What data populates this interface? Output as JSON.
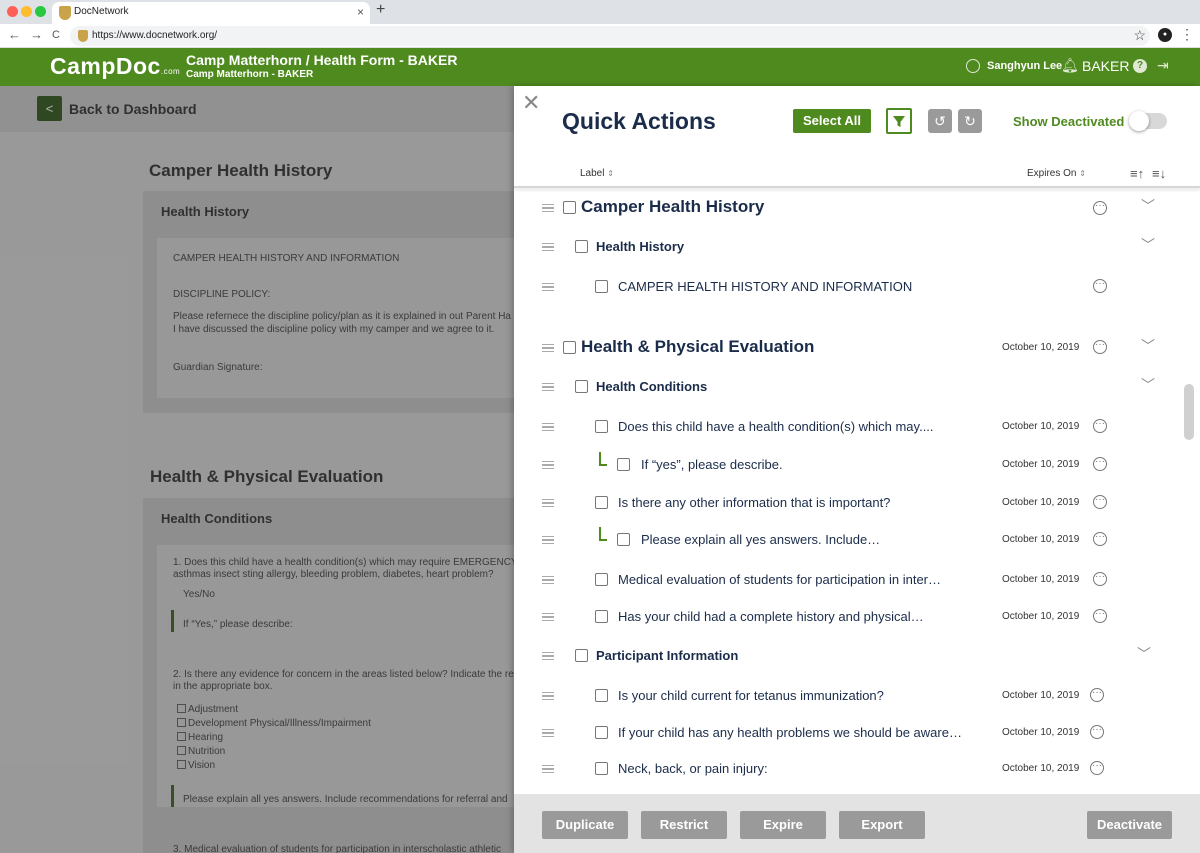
{
  "browser": {
    "tab_title": "DocNetwork",
    "tab_close": "×",
    "new_tab": "+",
    "url": "https://www.docnetwork.org/",
    "back": "←",
    "forward": "→",
    "reload": "C",
    "star": "☆",
    "menu": "⋮"
  },
  "app": {
    "logo": "CampDoc",
    "logo_suffix": ".com",
    "title": "Camp Matterhorn / Health Form - BAKER",
    "subtitle": "Camp Matterhorn - BAKER",
    "user_name": "Sanghyun Lee",
    "camp_code": "BAKER",
    "help": "?"
  },
  "background": {
    "back_label": "Back to Dashboard",
    "section1_title": "Camper Health History",
    "card1_title": "Health History",
    "card1_lines": [
      "CAMPER HEALTH HISTORY AND INFORMATION",
      "DISCIPLINE POLICY:",
      "Please refernece the discipline policy/plan as it is explained in out Parent Ha",
      "I have discussed the discipline policy with my camper and we agree to it.",
      "Guardian Signature:"
    ],
    "section2_title": "Health & Physical Evaluation",
    "card2_title": "Health Conditions",
    "q1_line1": "1. Does this child have a health condition(s) which may require EMERGENCY",
    "q1_line2": "asthmas insect sting allergy, bleeding problem, diabetes, heart problem?",
    "q1_answer": "Yes/No",
    "q1_followup": "If “Yes,” please describe:",
    "q2_line1": "2. Is there any evidence for concern in the areas listed below? Indicate the re",
    "q2_line2": "in the appropriate box.",
    "q2_options": [
      "Adjustment",
      "Development Physical/Illness/Impairment",
      "Hearing",
      "Nutrition",
      "Vision"
    ],
    "q2_followup": "Please explain all yes answers. Include recommendations for referral and",
    "q3_line1": "3. Medical evaluation of students for participation in interscholastic athletic"
  },
  "panel": {
    "title": "Quick Actions",
    "select_all": "Select All",
    "show_deactivated": "Show Deactivated",
    "col_label": "Label",
    "col_expires": "Expires On",
    "sort_arrows": "⇕",
    "show_deactivated_on": false,
    "rows": [
      {
        "label": "Camper Health History",
        "date": ""
      },
      {
        "label": "Health History",
        "date": ""
      },
      {
        "label": "CAMPER HEALTH HISTORY AND INFORMATION",
        "date": ""
      },
      {
        "label": "Health & Physical Evaluation",
        "date": "October 10, 2019"
      },
      {
        "label": "Health Conditions",
        "date": ""
      },
      {
        "label": "Does this child have a health condition(s) which may....",
        "date": "October 10, 2019"
      },
      {
        "label": "If “yes”, please describe.",
        "date": "October 10, 2019"
      },
      {
        "label": "Is there any other information that is important?",
        "date": "October 10, 2019"
      },
      {
        "label": "Please explain all yes answers. Include…",
        "date": "October 10, 2019"
      },
      {
        "label": "Medical evaluation of students for participation in inter…",
        "date": "October 10, 2019"
      },
      {
        "label": "Has your child had a complete history and physical…",
        "date": "October 10, 2019"
      },
      {
        "label": "Participant Information",
        "date": ""
      },
      {
        "label": "Is your child current for tetanus immunization?",
        "date": "October 10, 2019"
      },
      {
        "label": "If your child has any health problems we should be aware…",
        "date": "October 10, 2019"
      },
      {
        "label": "Neck, back, or pain injury:",
        "date": "October 10, 2019"
      }
    ],
    "footer": {
      "duplicate": "Duplicate",
      "restrict": "Restrict",
      "expire": "Expire",
      "export": "Export",
      "deactivate": "Deactivate"
    }
  },
  "colors": {
    "brand_green": "#4f8a1f",
    "dark_navy": "#1b2c4a",
    "button_gray": "#9a9a9a"
  }
}
